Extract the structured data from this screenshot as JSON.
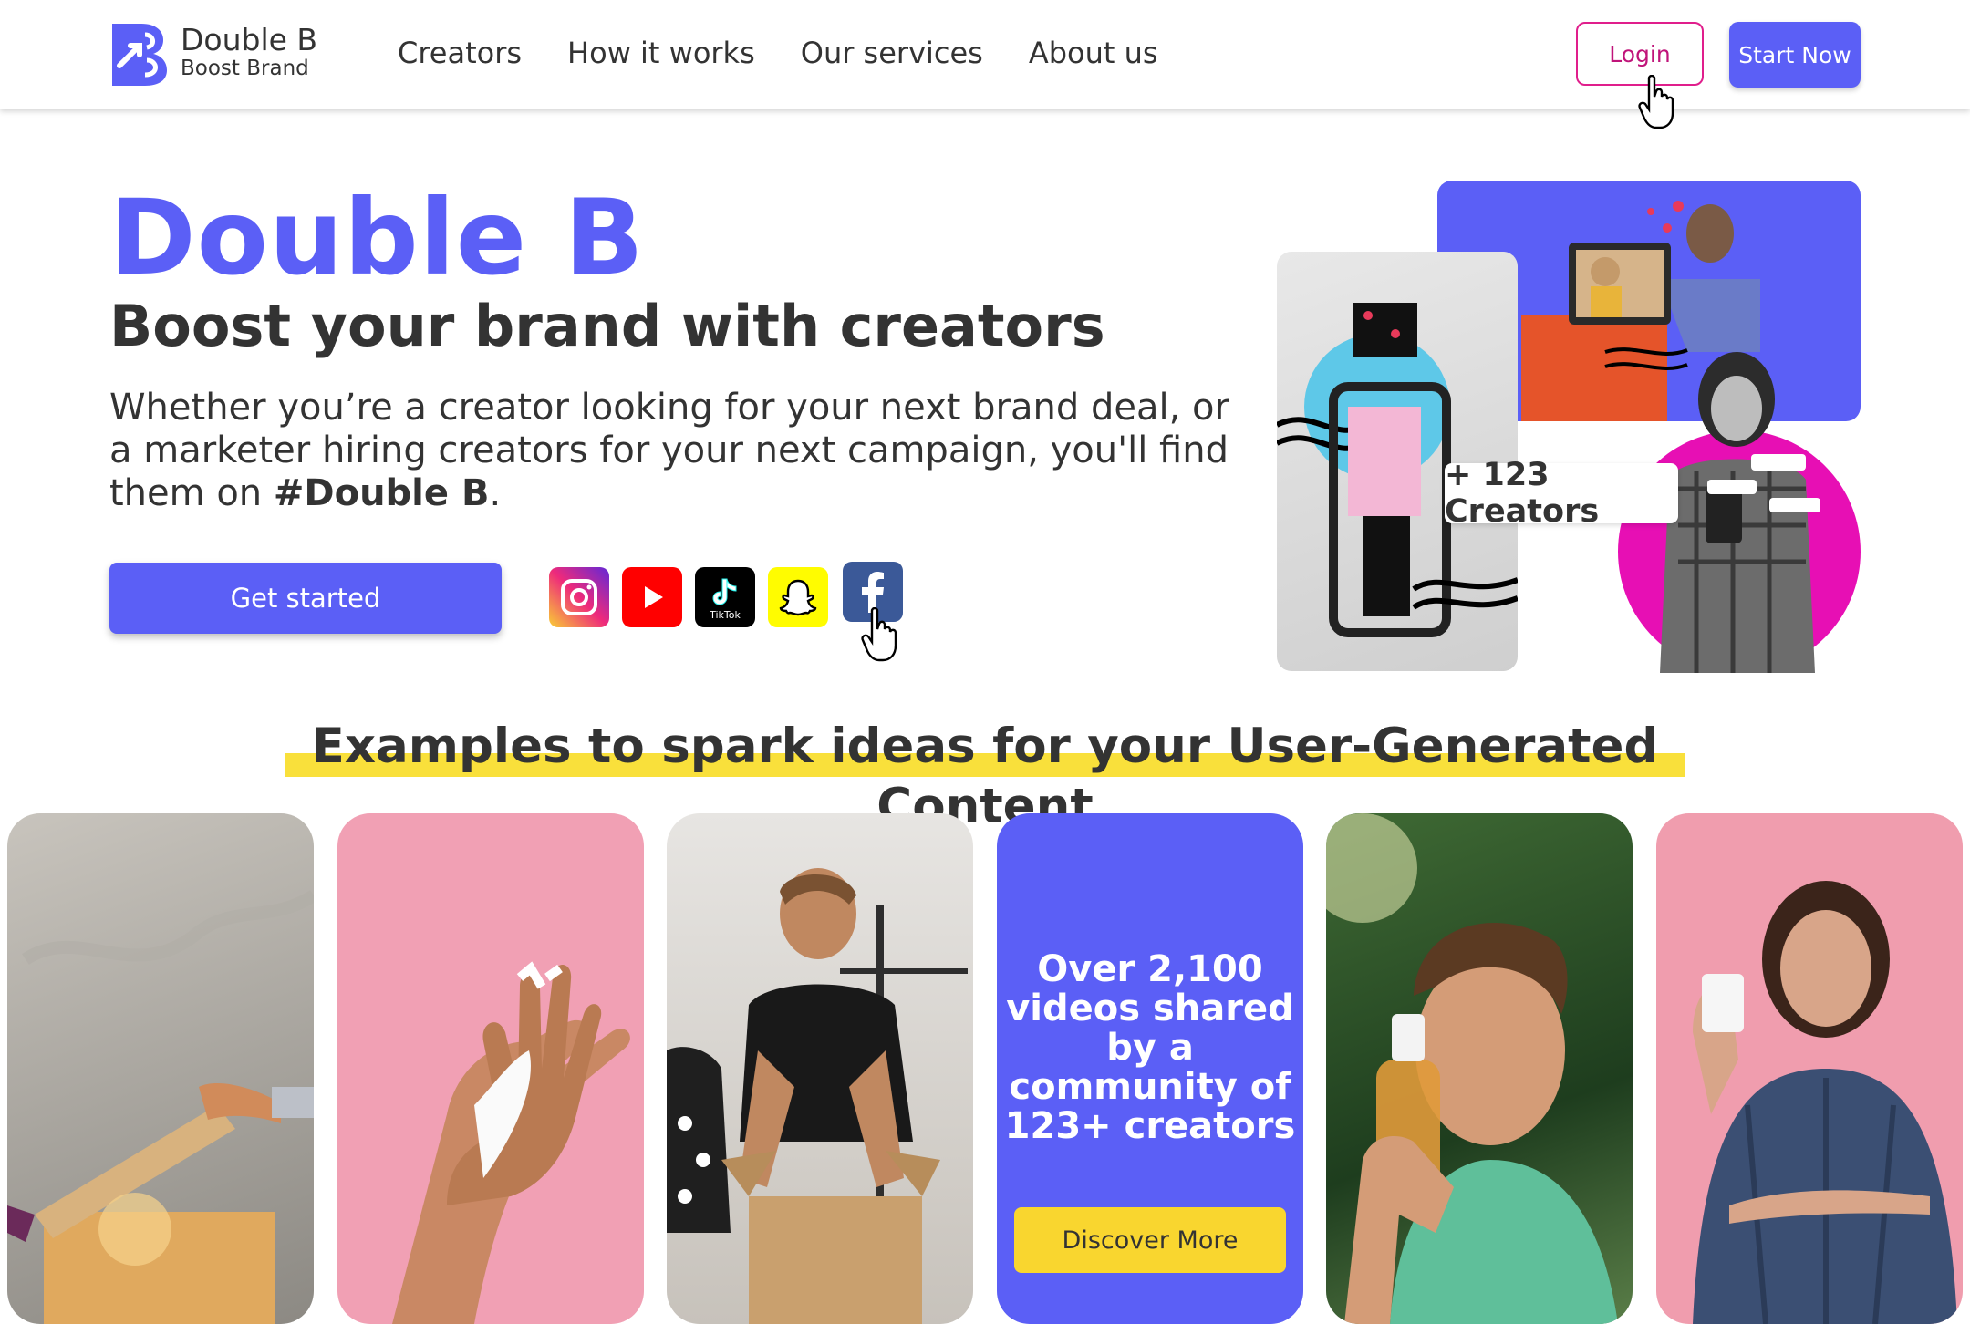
{
  "brand": {
    "name": "Double B",
    "tagline": "Boost Brand"
  },
  "nav": {
    "items": [
      "Creators",
      "How it works",
      "Our services",
      "About us"
    ]
  },
  "header": {
    "login_label": "Login",
    "start_label": "Start Now"
  },
  "hero": {
    "title": "Double B",
    "subtitle": "Boost your brand with creators",
    "description_prefix": "Whether you’re a creator looking for your next brand deal, or a marketer hiring creators for your next campaign,  you'll find them on ",
    "description_bold": "#Double B",
    "description_suffix": ".",
    "cta_label": "Get started",
    "creators_badge": "+ 123 Creators"
  },
  "social": [
    "instagram-icon",
    "youtube-icon",
    "tiktok-icon",
    "snapchat-icon",
    "facebook-icon"
  ],
  "social_text": {
    "tiktok": "TikTok"
  },
  "colors": {
    "accent": "#5b5ff6",
    "login": "#e01e8c",
    "highlight": "#f9e03b",
    "pink": "#e70fb4",
    "orange": "#e5542a"
  },
  "examples": {
    "title": "Examples to spark ideas for your User-Generated Content",
    "stat": "Over 2,100 videos shared by a community of 123+ creators",
    "discover_label": "Discover More"
  }
}
